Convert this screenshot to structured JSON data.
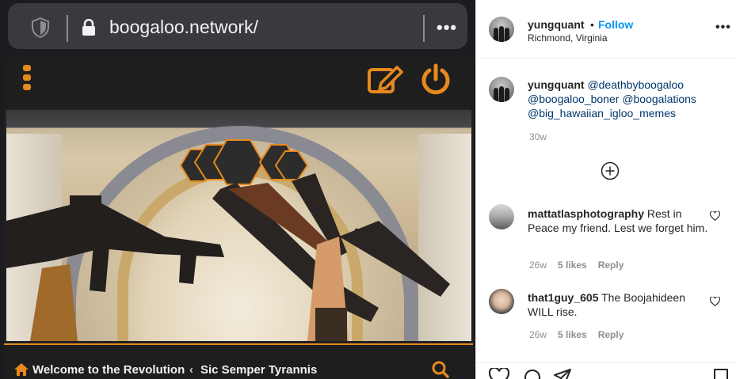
{
  "browser": {
    "url": "boogaloo.network/",
    "menu_glyph": "•••"
  },
  "site": {
    "breadcrumb_home": "Welcome to the Revolution",
    "breadcrumb_separator": "‹",
    "breadcrumb_current": "Sic Semper Tyrannis",
    "accent_color": "#e68a1e",
    "icons": [
      "menu-icon",
      "compose-icon",
      "power-icon",
      "home-icon",
      "search-icon"
    ]
  },
  "instagram": {
    "author": {
      "username": "yungquant",
      "follow_label": "Follow",
      "location": "Richmond, Virginia"
    },
    "more_glyph": "•••",
    "caption": {
      "username": "yungquant",
      "mentions": [
        "@deathbyboogaloo",
        "@boogaloo_boner",
        "@boogalations",
        "@big_hawaiian_igloo_memes"
      ],
      "age": "30w"
    },
    "comments": [
      {
        "username": "mattatlasphotography",
        "text": "Rest in Peace my friend. Lest we forget him.",
        "age": "26w",
        "likes": "5 likes",
        "reply_label": "Reply"
      },
      {
        "username": "that1guy_605",
        "text": "The Boojahideen WILL rise.",
        "age": "26w",
        "likes": "5 likes",
        "reply_label": "Reply"
      }
    ],
    "colors": {
      "link": "#0095f6",
      "mention": "#00376b",
      "muted": "#8e8e8e"
    }
  }
}
